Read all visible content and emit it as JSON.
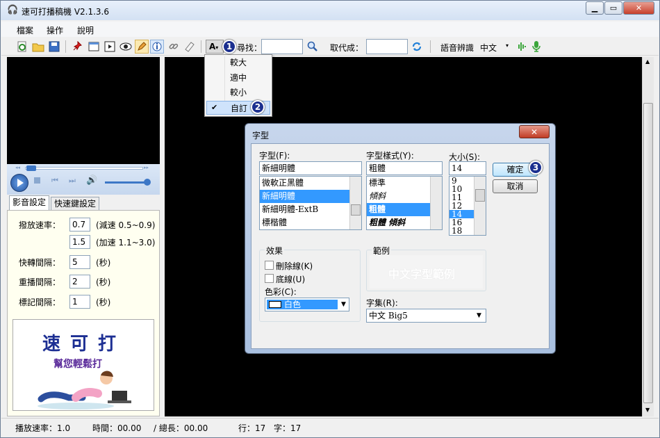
{
  "window": {
    "title": "速可打播稿機 V2.1.3.6"
  },
  "menu": {
    "items": [
      "檔案",
      "操作",
      "說明"
    ]
  },
  "toolbar": {
    "find_label": "尋找：",
    "replace_label": "取代成：",
    "speech_label": "語音辨識",
    "speech_lang": "中文",
    "font_button": "A"
  },
  "font_menu": {
    "items": [
      "較大",
      "適中",
      "較小",
      "自訂"
    ],
    "checked": "自訂"
  },
  "badges": [
    "1",
    "2",
    "3"
  ],
  "left": {
    "tabs": [
      "影音設定",
      "快速鍵設定"
    ],
    "settings": [
      {
        "label": "撥放速率：",
        "value": "0.7",
        "note": "(減速 0.5~0.9)"
      },
      {
        "label": "",
        "value": "1.5",
        "note": "(加速 1.1~3.0)"
      },
      {
        "label": "快轉間隔：",
        "value": "5",
        "note": "(秒)"
      },
      {
        "label": "重播間隔：",
        "value": "2",
        "note": "(秒)"
      },
      {
        "label": "標記間隔：",
        "value": "1",
        "note": "(秒)"
      }
    ],
    "logo_title": "速可打",
    "logo_slogan": "幫您輕鬆打"
  },
  "dialog": {
    "title": "字型",
    "font_label": "字型(F):",
    "font_value": "新細明體",
    "font_list": [
      "微軟正黑體",
      "新細明體",
      "新細明體-ExtB",
      "標楷體"
    ],
    "font_selected": 1,
    "style_label": "字型樣式(Y):",
    "style_value": "粗體",
    "style_list": [
      "標準",
      "傾斜",
      "粗體",
      "粗體 傾斜"
    ],
    "style_selected": 2,
    "size_label": "大小(S):",
    "size_value": "14",
    "size_list": [
      "9",
      "10",
      "11",
      "12",
      "14",
      "16",
      "18"
    ],
    "size_selected": 4,
    "ok_label": "確定",
    "cancel_label": "取消",
    "effects_label": "效果",
    "strike_label": "刪除線(K)",
    "underline_label": "底線(U)",
    "color_label": "色彩(C):",
    "color_value": "白色",
    "sample_label": "範例",
    "sample_text": "中文字型範例",
    "charset_label": "字集(R):",
    "charset_value": "中文 Big5"
  },
  "status": {
    "speed": "播放速率：1.0",
    "time": "時間：00.00",
    "length": "/ 總長：00.00",
    "line": "行：17",
    "char": "字：17"
  },
  "colors": {
    "accent": "#3399ff",
    "badge": "#1b2f8f",
    "video_bg": "#000000"
  }
}
